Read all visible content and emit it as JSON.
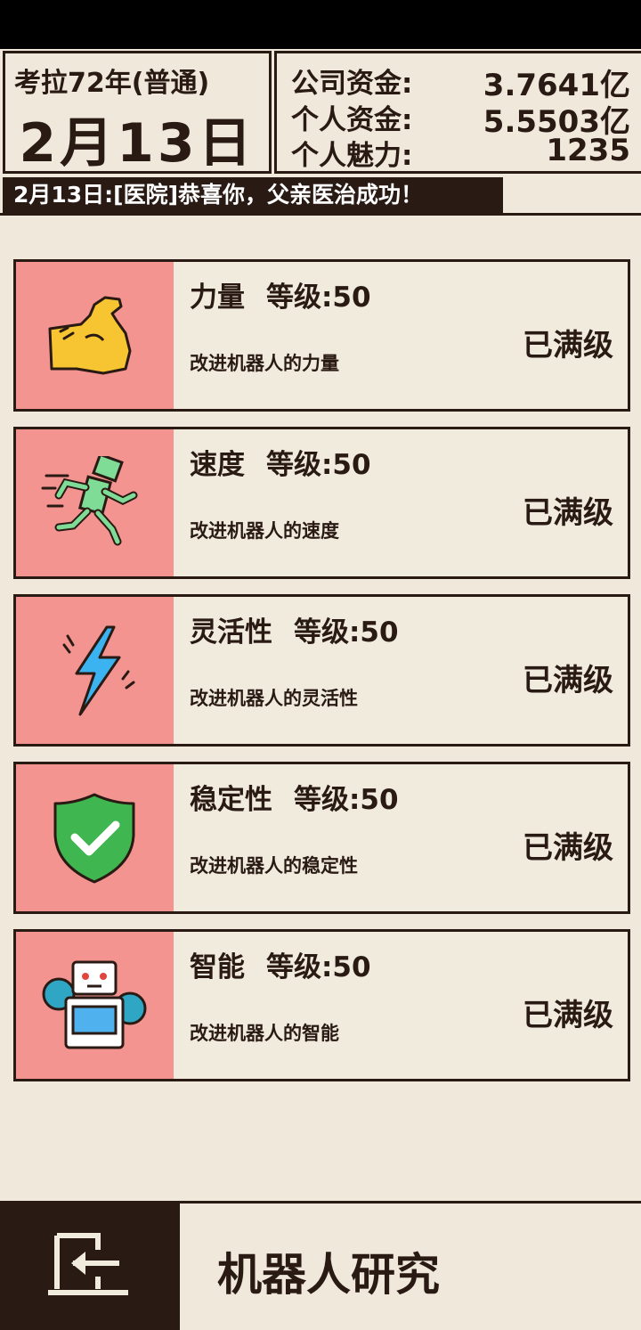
{
  "header": {
    "era": "考拉72年(普通)",
    "date": "2月13日",
    "stats": [
      {
        "label": "公司资金:",
        "value": "3.7641亿"
      },
      {
        "label": "个人资金:",
        "value": "5.5503亿"
      },
      {
        "label": "个人魅力:",
        "value": "1235"
      }
    ]
  },
  "news": "2月13日:[医院]恭喜你，父亲医治成功！",
  "upgrades": [
    {
      "name": "力量",
      "level": "等级:50",
      "desc": "改进机器人的力量",
      "status": "已满级",
      "icon": "flexed-arm-icon"
    },
    {
      "name": "速度",
      "level": "等级:50",
      "desc": "改进机器人的速度",
      "status": "已满级",
      "icon": "running-robot-icon"
    },
    {
      "name": "灵活性",
      "level": "等级:50",
      "desc": "改进机器人的灵活性",
      "status": "已满级",
      "icon": "lightning-icon"
    },
    {
      "name": "稳定性",
      "level": "等级:50",
      "desc": "改进机器人的稳定性",
      "status": "已满级",
      "icon": "shield-check-icon"
    },
    {
      "name": "智能",
      "level": "等级:50",
      "desc": "改进机器人的智能",
      "status": "已满级",
      "icon": "robot-gear-icon"
    }
  ],
  "footer": {
    "title": "机器人研究",
    "back_icon": "exit-door-icon"
  },
  "colors": {
    "icon_panel": "#f49491",
    "dark": "#2a1a14",
    "background": "#efe8db"
  }
}
